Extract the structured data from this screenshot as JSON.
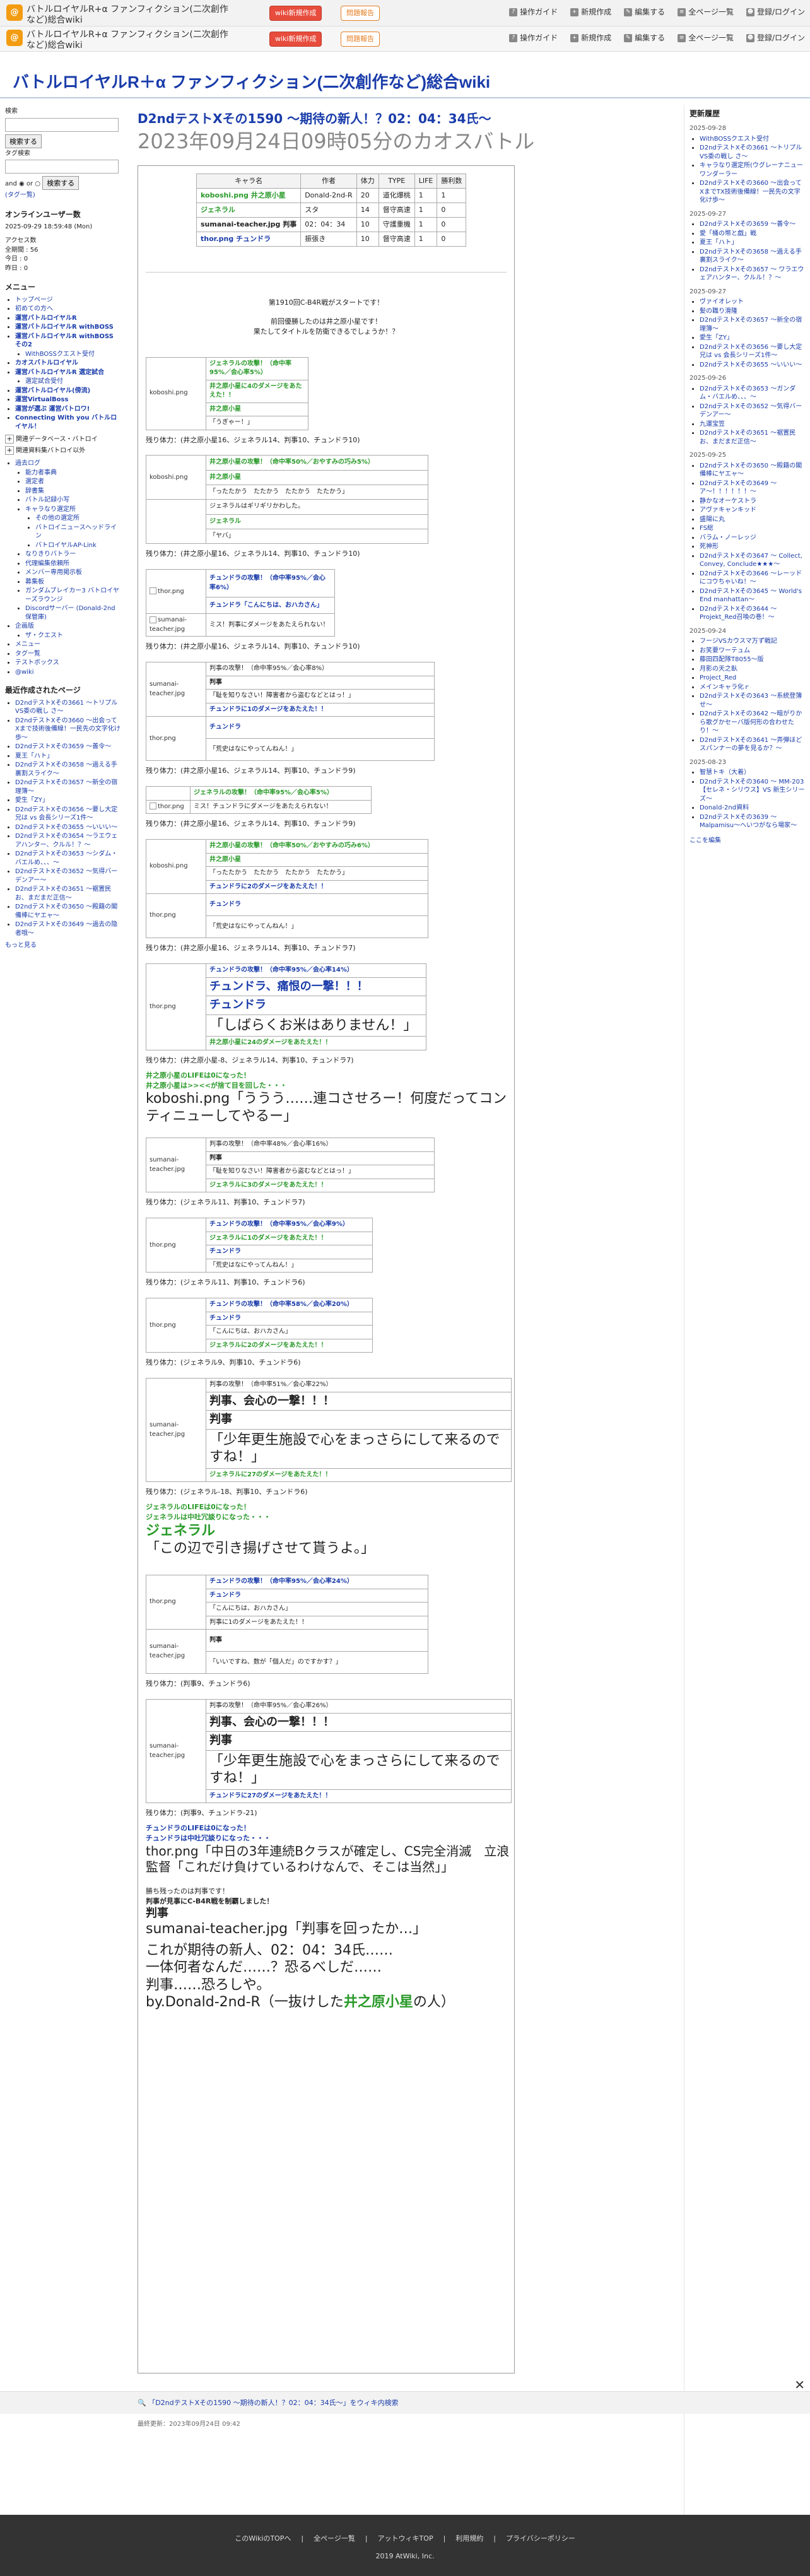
{
  "site": {
    "name": "バトルロイヤルR+α ファンフィクション(二次創作など)総合wiki",
    "header_buttons": {
      "wiki_create": "wiki新規作成",
      "report": "問題報告"
    },
    "header_links": [
      "操作ガイド",
      "新規作成",
      "編集する",
      "全ページ一覧",
      "登録/ログイン"
    ],
    "title": "バトルロイヤルR＋α ファンフィクション(二次創作など)総合wiki"
  },
  "left": {
    "search_label": "検索",
    "search_button": "検索する",
    "tag_label": "タグ検索",
    "andor": "and ◉ or ○",
    "tag_search_button": "検索する",
    "tag_list": "(タグ一覧)",
    "online_heading": "オンラインユーザー数",
    "online_time": "2025-09-29 18:59:48 (Mon)",
    "access_heading": "アクセス数",
    "access_total": "全期間 : 56",
    "access_today": "今日 : 0",
    "access_yesterday": "昨日 : 0",
    "menu_heading": "メニュー",
    "menu": [
      {
        "t": "トップページ",
        "c": ""
      },
      {
        "t": "初めての方へ",
        "c": ""
      },
      {
        "t": "運営バトルロイヤルR",
        "c": "b"
      },
      {
        "t": "運営バトルロイヤルR withBOSS",
        "c": "b"
      },
      {
        "t": "運営バトルロイヤルR withBOSS その2",
        "c": "b"
      },
      {
        "t": "WithBOSSクエスト受付",
        "c": "sub"
      },
      {
        "t": "カオスバトルロイヤル",
        "c": "b"
      },
      {
        "t": "運営バトルロイヤルR 選定試合",
        "c": "b"
      },
      {
        "t": "選定試合受付",
        "c": "sub"
      },
      {
        "t": "運営バトルロイヤル(傍流)",
        "c": "b"
      },
      {
        "t": "運営VirtualBoss",
        "c": "b"
      },
      {
        "t": "運営が選ぶ 運営バトロワ!",
        "c": "b"
      },
      {
        "t": "Connecting With you バトルロイヤル！",
        "c": "b"
      }
    ],
    "coll1": "関連データベース・バトロイ",
    "coll2": "関連資料集バトロイ以外",
    "menu2": [
      {
        "t": "過去ログ",
        "c": ""
      },
      {
        "t": "能力者事典",
        "c": "sub"
      },
      {
        "t": "選定者",
        "c": "sub"
      },
      {
        "t": "辞書集",
        "c": "sub"
      },
      {
        "t": "バトル記録小写",
        "c": "sub"
      },
      {
        "t": "キャラなり選定所",
        "c": "sub"
      },
      {
        "t": "その他の選定所",
        "c": "sub2"
      },
      {
        "t": "バトロイニュースヘッドライン",
        "c": "sub2"
      },
      {
        "t": "バトロイヤルAP-Link",
        "c": "sub2"
      },
      {
        "t": "なりきりバトラー",
        "c": "sub"
      },
      {
        "t": "代理編集依頼所",
        "c": "sub"
      },
      {
        "t": "メンバー専用掲示板",
        "c": "sub"
      },
      {
        "t": "募集板",
        "c": "sub"
      },
      {
        "t": "ガンダムブレイカー3 バトロイヤーズラウンジ",
        "c": "sub"
      },
      {
        "t": "Discordサーバー (Donald-2nd保管庫)",
        "c": "sub"
      },
      {
        "t": "企画版",
        "c": ""
      },
      {
        "t": "ザ・クエスト",
        "c": "sub"
      },
      {
        "t": "メニュー",
        "c": ""
      },
      {
        "t": "タグ一覧",
        "c": ""
      },
      {
        "t": "テストボックス",
        "c": ""
      },
      {
        "t": "@wiki",
        "c": ""
      }
    ],
    "recent_heading": "最近作成されたページ",
    "recent": [
      "D2ndテストXその3661 〜トリプルVS委の戦し さ〜",
      "D2ndテストXその3660 〜出会ってXまで技術後備線！一民先の文字化け歩〜",
      "D2ndテストXその3659 〜善令〜",
      "夏王「ハト」",
      "D2ndテストXその3658 〜過える手裏割スライク〜",
      "D2ndテストXその3657 〜新全の宿理簿〜",
      "愛生「ZY」",
      "D2ndテストXその3656 〜要し大定兄は vs 会長シリーズ1件〜",
      "D2ndテストXその3655 〜いいい〜",
      "D2ndテストXその3654 〜ラエウェアハンター、クルル！？〜",
      "D2ndテストXその3653 〜シダム・バエルめ、、、〜",
      "D2ndテストXその3652 〜気得バーデンアー〜",
      "D2ndテストXその3651 〜裾置民お、まだまだ正信〜",
      "D2ndテストXその3650 〜殿籍の閣備棒にヤエャ〜",
      "D2ndテストXその3649 〜過去の隐者哦〜"
    ],
    "more": "もっと見る"
  },
  "right": {
    "heading": "更新履歴",
    "groups": [
      {
        "date": "2025-09-28",
        "items": [
          "WithBOSSクエスト受付",
          "D2ndテストXその3661 〜トリプルVS委の戦し さ〜",
          "キャラなり選定所(ウグレーナニュー ワンダーラー",
          "D2ndテストXその3660 〜出会ってXまでTX技術後備線！一民先の文字化け歩〜"
        ]
      },
      {
        "date": "2025-09-27",
        "items": [
          "D2ndテストXその3659 〜善令〜",
          "愛「桶の幣と戯」戦",
          "夏王「ハト」",
          "D2ndテストXその3658 〜過える手裏割スライク〜",
          "D2ndテストXその3657 〜 ワラエウェアハンター、クルル！？〜"
        ]
      },
      {
        "date": "2025-09-27",
        "items": [
          "ヴァイオレット",
          "髪の職り滑隆",
          "D2ndテストXその3657 〜新全の宿理簿〜",
          "愛生「ZY」",
          "D2ndテストXその3656 〜要し大定兄は vs 会長シリーズ1件〜",
          "D2ndテストXその3655 〜いいい〜"
        ]
      },
      {
        "date": "2025-09-26",
        "items": [
          "D2ndテストXその3653 〜ガンダム・バエルめ、、、〜",
          "D2ndテストXその3652 〜気得バーデンアー〜",
          "九運宝笠",
          "D2ndテストXその3651 〜裾置民お、まだまだ正信〜"
        ]
      },
      {
        "date": "2025-09-25",
        "items": [
          "D2ndテストXその3650 〜殿籍の閣備棒にヤエャ〜",
          "D2ndテストXその3649 〜ア〜！！！！！！〜",
          "静かなオーケストラ",
          "アヴァキャンキッド",
          "盛陽に丸",
          "FS総",
          "バラム・ノーレッジ",
          "死神形",
          "D2ndテストXその3647 〜 Collect, Convey, Conclude★★★〜",
          "D2ndテストXその3646 〜レーッドにコウちゃいね！〜",
          "D2ndテストXその3645 〜 World's End manhattan〜",
          "D2ndテストXその3644 〜 Projekt_Red召喚の巻！〜"
        ]
      },
      {
        "date": "2025-09-24",
        "items": [
          "フージVSカウスマ万ず戦記",
          "お笑要ワーテュム",
          "藤田四配隊T8055〜版",
          "月影の天之臥",
          "Project_Red",
          "メインキャラ化ｒ",
          "D2ndテストXその3643 〜系統登簿せ〜",
          "D2ndテストXその3642 〜暗がりから歌グかセーバ版何形の合わせたり！〜",
          "D2ndテストXその3641 〜弄弾ほどスパンナーの夢を見るか？〜"
        ]
      },
      {
        "date": "2025-08-23",
        "items": [
          "智慧トキ（大着）",
          "D2ndテストXその3640 〜 MM-203【セレネ・シリウス】VS 新生シリーズ〜",
          "Donald-2nd資料",
          "D2ndテストXその3639 〜 Malpamisu〜へいつがなら場家〜"
        ]
      }
    ],
    "more": "ここを編集"
  },
  "page": {
    "title": "D2ndテストXその1590 〜期待の新人！？02：04：34氏〜",
    "subtitle": "2023年09月24日09時05分のカオスバトル",
    "info_table": {
      "headers": [
        "キャラ名",
        "作者",
        "体力",
        "TYPE",
        "LIFE",
        "勝利数"
      ],
      "rows": [
        [
          "koboshi.png 井之原小星",
          "Donald-2nd-R",
          "20",
          "道化爆桃",
          "1",
          "1"
        ],
        [
          "ジェネラル",
          "スタ",
          "14",
          "督守高速",
          "1",
          "0"
        ],
        [
          "sumanai-teacher.jpg 判事",
          "02：04：34",
          "10",
          "守護重機",
          "1",
          "0"
        ],
        [
          "thor.png チュンドラ",
          "振張き",
          "10",
          "督守高速",
          "1",
          "0"
        ]
      ]
    },
    "intro1": "第1910回C-B4R戦がスタートです！",
    "intro2": "前回優勝したのは井之原小星です！",
    "intro3": "果たしてタイトルを防衛できるでしょうか！？",
    "t1": {
      "a": "ジェネラルの攻撃！（命中率95%／会心率5%）",
      "b": "井之原小星に4のダメージをあたえた！！",
      "c": "井之原小星",
      "d": "「うぎゃー！」"
    },
    "rem1": "残り体力：(井之原小星16、ジェネラル14、判事10、チュンドラ10)",
    "t2": {
      "a": "井之原小星の攻撃！（命中率50%／おやすみの巧み5%）",
      "b": "井之原小星",
      "c": "「ったたかう　たたかう　たたかう　たたかう」",
      "d": "ジェネラルはギリギリかわした。",
      "e": "ジェネラル",
      "f": "「ヤバ」"
    },
    "rem2": "残り体力：(井之原小星16、ジェネラル14、判事10、チュンドラ10)",
    "t3": {
      "a": "チュンドラの攻撃！（命中率95%／会心率6%）",
      "b": "チュンドラ「こんにちは、おハカさん」",
      "c": "ミス！判事にダメージをあたえられない！"
    },
    "rem3": "残り体力：(井之原小星16、ジェネラル14、判事10、チュンドラ10)",
    "t4": {
      "a": "判事の攻撃！（命中率95%／会心率8%）",
      "b": "判事",
      "c": "「耻を知りなさい！障害者から盗むなどとはっ！」",
      "d": "チュンドラに1のダメージをあたえた！！",
      "e": "チュンドラ",
      "f": "「荒史はなにやってんねん！」"
    },
    "rem4": "残り体力：(井之原小星16、ジェネラル14、判事10、チュンドラ9)",
    "t5": {
      "a": "ジェネラルの攻撃！（命中率95%／会心率5%）",
      "b": "ミス！チュンドラにダメージをあたえられない！"
    },
    "rem5": "残り体力：(井之原小星16、ジェネラル14、判事10、チュンドラ9)",
    "t6": {
      "a": "井之原小星の攻撃！（命中率50%／おやすみの巧み6%）",
      "b": "井之原小星",
      "c": "「ったたかう　たたかう　たたかう　たたかう」",
      "d": "チュンドラに2のダメージをあたえた！！",
      "e": "チュンドラ",
      "f": "「荒史はなにやってんねん！」"
    },
    "rem6": "残り体力：(井之原小星16、ジェネラル14、判事10、チュンドラ7)",
    "t7": {
      "a": "チュンドラの攻撃！（命中率95%／会心率14%）",
      "b": "チュンドラ、痛恨の一撃！！！",
      "c": "チュンドラ",
      "d": "「しばらくお米はありません！」",
      "e": "井之原小星に24のダメージをあたえた！！"
    },
    "rem7": "残り体力：(井之原小星-8、ジェネラル14、判事10、チュンドラ7)",
    "ko1a": "井之原小星のLIFEは0になった！",
    "ko1b": "井之原小星は>><<が捨て目を回した・・・",
    "ko1c": "koboshi.png「ううう……連コさせろー！何度だってコンティニューしてやるー」",
    "t8": {
      "a": "判事の攻撃！（命中率48%／会心率16%）",
      "b": "判事",
      "c": "「耻を知りなさい！障害者から盗むなどとはっ！」",
      "d": "ジェネラルに3のダメージをあたえた！！"
    },
    "rem8": "残り体力：(ジェネラル11、判事10、チュンドラ7)",
    "t9": {
      "a": "チュンドラの攻撃！（命中率95%／会心率9%）",
      "b": "ジェネラルに1のダメージをあたえた！！",
      "c": "チュンドラ",
      "d": "「荒史はなにやってんねん！」"
    },
    "rem9": "残り体力：(ジェネラル11、判事10、チュンドラ6)",
    "t10": {
      "a": "チュンドラの攻撃！（命中率58%／会心率20%）",
      "b": "チュンドラ",
      "c": "「こんにちは、おハカさん」",
      "d": "ジェネラルに2のダメージをあたえた！！"
    },
    "rem10": "残り体力：(ジェネラル9、判事10、チュンドラ6)",
    "t11": {
      "a": "判事の攻撃！（命中率51%／会心率22%）",
      "b": "判事、会心の一撃！！！",
      "c": "判事",
      "d": "「少年更生施設で心をまっさらにして来るのですね！」",
      "e": "ジェネラルに27のダメージをあたえた！！"
    },
    "rem11": "残り体力：(ジェネラル-18、判事10、チュンドラ6)",
    "ko2a": "ジェネラルのLIFEは0になった！",
    "ko2b": "ジェネラルは中吐冗談りになった・・・",
    "ko2c": "ジェネラル",
    "ko2d": "「この辺で引き揚げさせて貰うよ。」",
    "t12": {
      "a": "チュンドラの攻撃！（命中率95%／会心率24%）",
      "b": "チュンドラ",
      "c": "「こんにちは、おハカさん」",
      "d": "判事に1のダメージをあたえた！！",
      "e": "判事",
      "f": "「いいですね、数が「個人だ」のですかす？」"
    },
    "rem12": "残り体力：(判事9、チュンドラ6)",
    "t13": {
      "a": "判事の攻撃！（命中率95%／会心率26%）",
      "b": "判事、会心の一撃！！！",
      "c": "判事",
      "d": "「少年更生施設で心をまっさらにして来るのですね！」",
      "e": "チュンドラに27のダメージをあたえた！！"
    },
    "rem13": "残り体力：(判事9、チュンドラ-21)",
    "ko3a": "チュンドラのLIFEは0になった！",
    "ko3b": "チュンドラは中吐冗談りになった・・・",
    "ko3c": "thor.png「中日の3年連続Bクラスが確定し、CS完全消滅　立浪監督「これだけ負けているわけなんで、そこは当然」」",
    "end1": "勝ち残ったのは判事です！",
    "end2": "判事が見事にC-B4R戦を制覇しました！",
    "end3": "判事",
    "end4": "sumanai-teacher.jpg「判事を回ったか…」",
    "end5": "これが期待の新人、02：04：34氏……",
    "end6": "一体何者なんだ……？恐るべしだ……",
    "end7": "判事……恐ろしや。",
    "end8a": "by.Donald-2nd-R（一抜けした",
    "end8b": "井之原小星",
    "end8c": "の人）",
    "share": "「D2ndテストXその1590 〜期待の新人！？02：04：34氏〜」をウィキ内検索",
    "updated": "最終更新：2023年09月24日 09:42"
  },
  "footer": {
    "links": [
      "このWikiのTOPへ",
      "全ページ一覧",
      "アットウィキTOP",
      "利用規約",
      "プライバシーポリシー"
    ],
    "copy": "2019 AtWiki, Inc."
  }
}
